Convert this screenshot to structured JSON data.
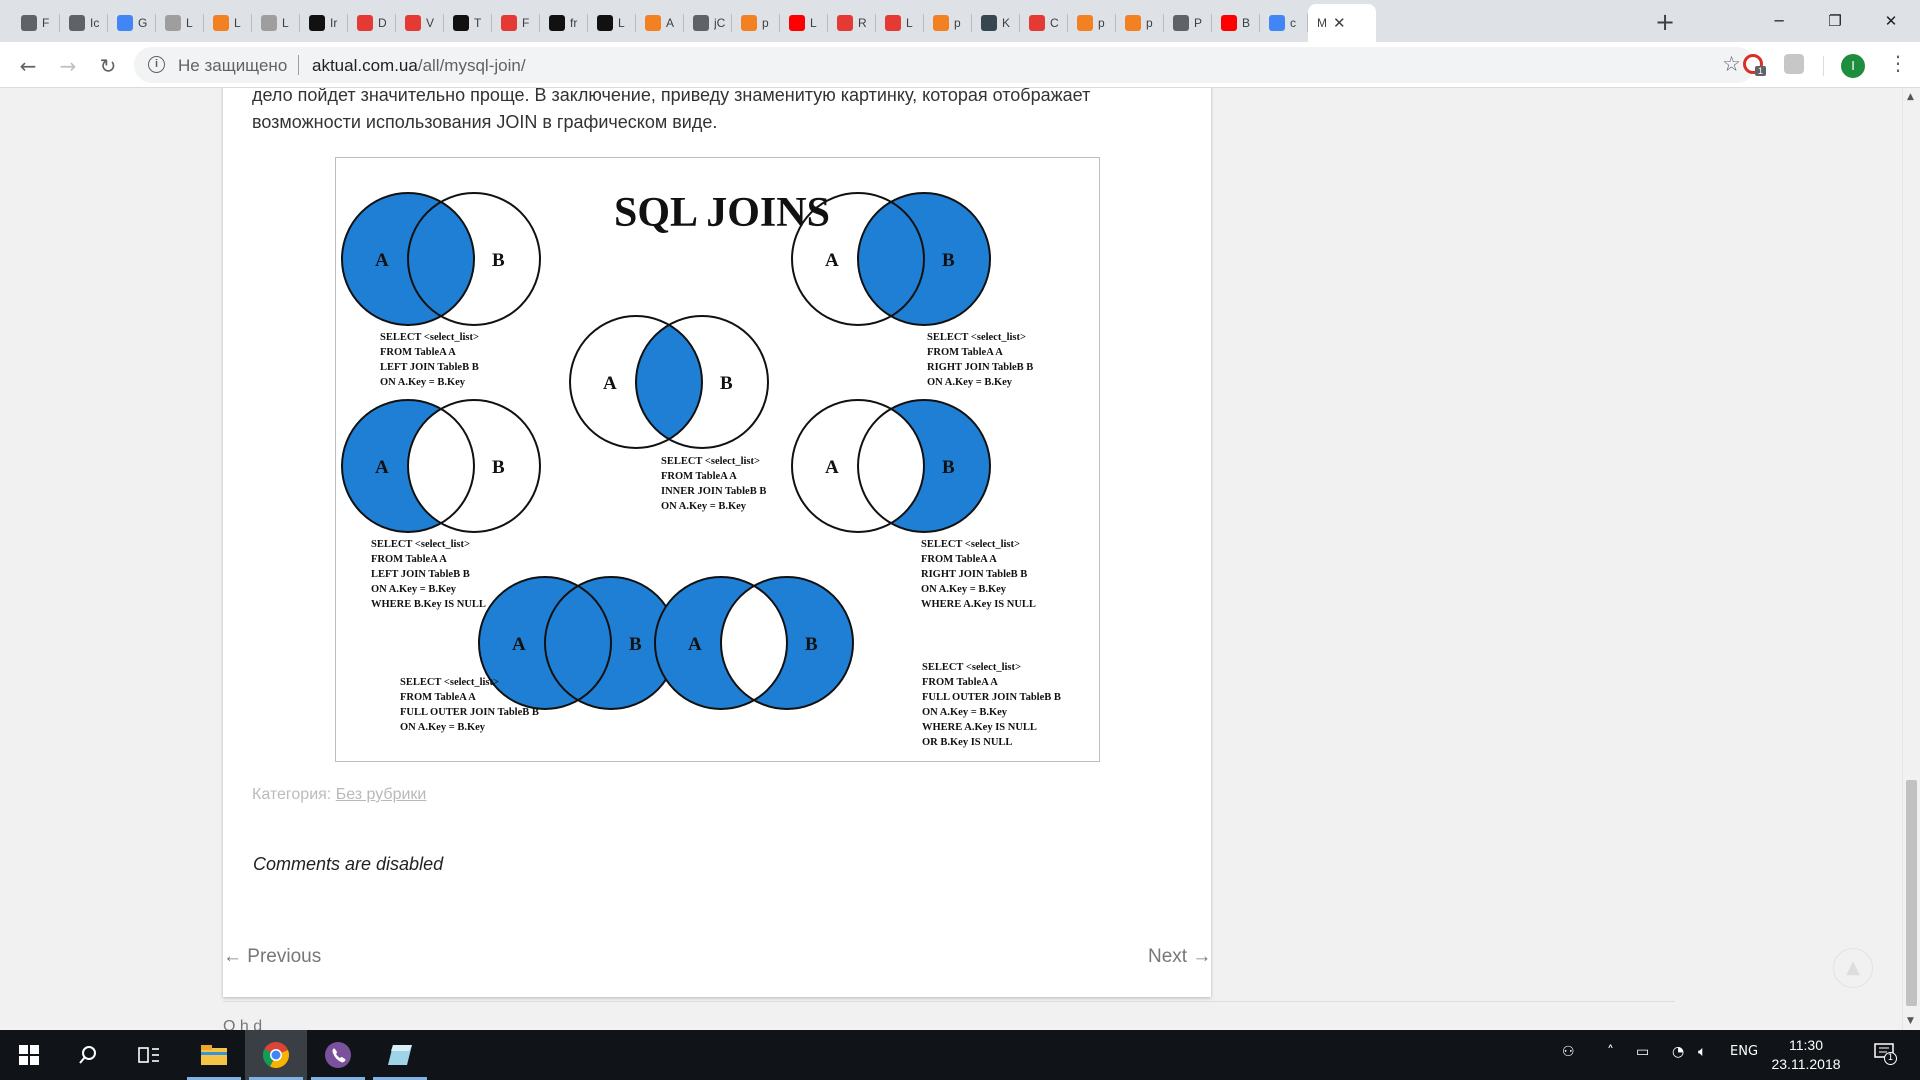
{
  "browser": {
    "tabs": [
      {
        "icon": "page-icon",
        "label": "F",
        "color": "#5f6368"
      },
      {
        "icon": "page-icon",
        "label": "Ic",
        "color": "#5f6368"
      },
      {
        "icon": "translate-icon",
        "label": "G",
        "color": "#4285f4"
      },
      {
        "icon": "site-thumb-icon",
        "label": "L",
        "color": "#9e9e9e"
      },
      {
        "icon": "stackoverflow-icon",
        "label": "L",
        "color": "#f48024"
      },
      {
        "icon": "site-thumb-icon",
        "label": "L",
        "color": "#9e9e9e"
      },
      {
        "icon": "github-icon",
        "label": "Ir",
        "color": "#111111"
      },
      {
        "icon": "red-site-icon",
        "label": "D",
        "color": "#e53935"
      },
      {
        "icon": "red-site-icon",
        "label": "V",
        "color": "#e53935"
      },
      {
        "icon": "medium-icon",
        "label": "T",
        "color": "#111111"
      },
      {
        "icon": "red-site-icon",
        "label": "F",
        "color": "#e53935"
      },
      {
        "icon": "github-icon",
        "label": "fr",
        "color": "#111111"
      },
      {
        "icon": "dev-icon",
        "label": "L",
        "color": "#111111"
      },
      {
        "icon": "stackoverflow-icon",
        "label": "A",
        "color": "#f48024"
      },
      {
        "icon": "page-icon",
        "label": "jC",
        "color": "#5f6368"
      },
      {
        "icon": "stackoverflow-icon",
        "label": "p",
        "color": "#f48024"
      },
      {
        "icon": "youtube-icon",
        "label": "L",
        "color": "#ff0000"
      },
      {
        "icon": "red-site-icon",
        "label": "R",
        "color": "#e53935"
      },
      {
        "icon": "red-circle-icon",
        "label": "L",
        "color": "#e53935"
      },
      {
        "icon": "stackoverflow-icon",
        "label": "p",
        "color": "#f48024"
      },
      {
        "icon": "t-icon",
        "label": "K",
        "color": "#37474f"
      },
      {
        "icon": "red-site-icon",
        "label": "C",
        "color": "#e53935"
      },
      {
        "icon": "stackoverflow-icon",
        "label": "p",
        "color": "#f48024"
      },
      {
        "icon": "stackoverflow-icon",
        "label": "p",
        "color": "#f48024"
      },
      {
        "icon": "send-icon",
        "label": "P",
        "color": "#5f6368"
      },
      {
        "icon": "youtube-icon",
        "label": "B",
        "color": "#ff0000"
      },
      {
        "icon": "google-icon",
        "label": "c",
        "color": "#4285f4"
      }
    ],
    "active_tab": {
      "label": "M"
    },
    "new_tab": "+",
    "window": {
      "minimize": "─",
      "restore": "❐",
      "close": "✕"
    },
    "address": {
      "security": "Не защищено",
      "host": "aktual.com.ua",
      "path": "/all/mysql-join/"
    },
    "profile_initial": "I",
    "extension_badge": "1"
  },
  "article": {
    "paragraph": "дело пойдет значительно проще. В заключение, приведу знаменитую картинку, которая отображает возможности использования JOIN в графическом виде.",
    "category_label": "Категория:",
    "category_link": "Без рубрики",
    "comments": "Comments are disabled"
  },
  "diagram": {
    "title": "SQL JOINS",
    "fill_color": "#1f7fd4",
    "label_a": "A",
    "label_b": "B",
    "snippets": {
      "left_join": [
        "SELECT <select_list>",
        "FROM TableA A",
        "LEFT JOIN TableB B",
        "ON A.Key = B.Key"
      ],
      "right_join": [
        "SELECT <select_list>",
        "FROM TableA A",
        "RIGHT JOIN TableB B",
        "ON A.Key = B.Key"
      ],
      "inner_join": [
        "SELECT <select_list>",
        "FROM TableA A",
        "INNER JOIN TableB B",
        "ON A.Key = B.Key"
      ],
      "left_null": [
        "SELECT <select_list>",
        "FROM TableA A",
        "LEFT JOIN TableB B",
        "ON A.Key = B.Key",
        "WHERE B.Key IS NULL"
      ],
      "right_null": [
        "SELECT <select_list>",
        "FROM TableA A",
        "RIGHT JOIN TableB B",
        "ON A.Key = B.Key",
        "WHERE A.Key IS NULL"
      ],
      "full_outer": [
        "SELECT <select_list>",
        "FROM TableA A",
        "FULL OUTER JOIN TableB B",
        "ON A.Key = B.Key"
      ],
      "full_outer_null": [
        "SELECT <select_list>",
        "FROM TableA A",
        "FULL OUTER JOIN TableB B",
        "ON A.Key = B.Key",
        "WHERE A.Key IS NULL",
        "OR B.Key IS NULL"
      ]
    }
  },
  "post_nav": {
    "previous": "← Previous",
    "next": "Next →"
  },
  "partial_text": "O h d",
  "taskbar": {
    "language": "ENG",
    "time": "11:30",
    "date": "23.11.2018",
    "notification_count": "1"
  }
}
